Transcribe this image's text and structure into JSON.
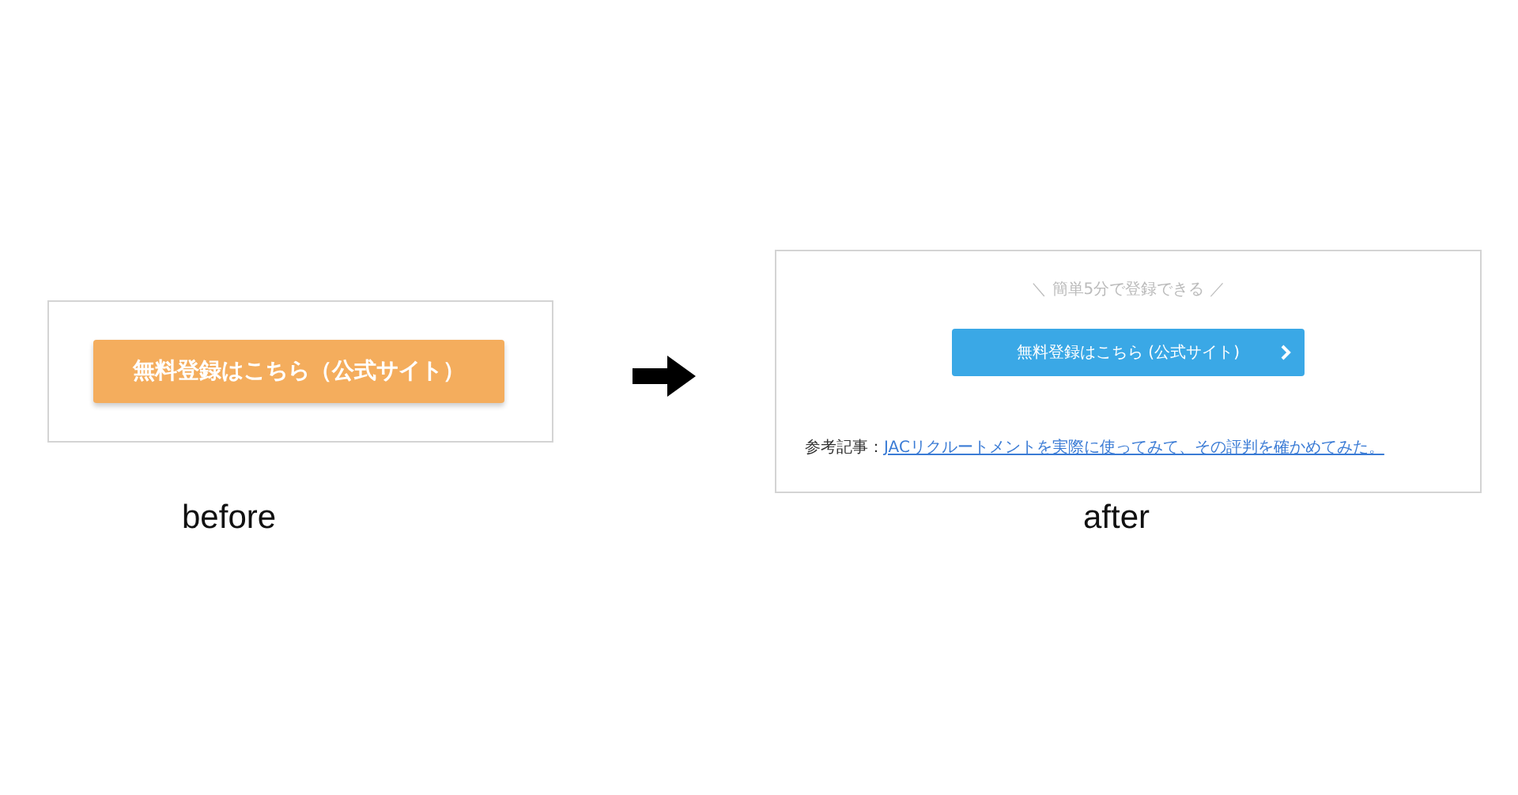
{
  "before": {
    "button": "無料登録はこちら（公式サイト）",
    "label": "before"
  },
  "after": {
    "headline": "＼ 簡単5分で登録できる ／",
    "button": "無料登録はこちら (公式サイト)",
    "reference_label": "参考記事：",
    "reference_link": "JACリクルートメントを実際に使ってみて、その評判を確かめてみた。",
    "label": "after"
  }
}
